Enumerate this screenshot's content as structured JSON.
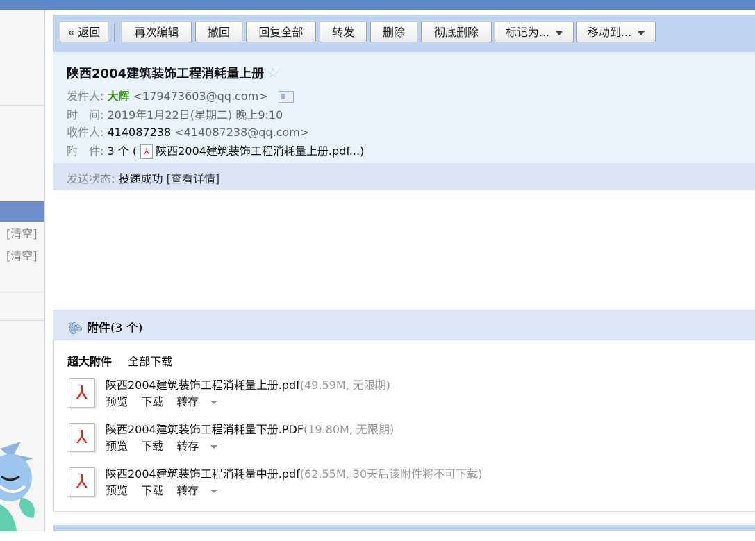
{
  "sidebar": {
    "clear_1": "[清空]",
    "clear_2": "[清空]"
  },
  "toolbar": {
    "back": "« 返回",
    "re_edit": "再次编辑",
    "recall": "撤回",
    "reply_all": "回复全部",
    "forward": "转发",
    "delete": "删除",
    "delete_permanently": "彻底删除",
    "mark_as": "标记为...",
    "move_to": "移动到..."
  },
  "email": {
    "subject": "陕西2004建筑装饰工程消耗量上册",
    "star": "☆",
    "sender_label": "发件人:",
    "sender_name": "大辉",
    "sender_email": "<179473603@qq.com>",
    "time_label": "时　间:",
    "time": "2019年1月22日(星期二) 晚上9:10",
    "recipient_label": "收件人:",
    "recipient_name": "414087238",
    "recipient_email": "<414087238@qq.com>",
    "attachment_label": "附　件:",
    "attachment_count": "3 个 (",
    "attachment_first": "陕西2004建筑装饰工程消耗量上册.pdf...)",
    "status_label": "发送状态:",
    "status_value": "投递成功",
    "status_link": "[查看详情]"
  },
  "attachments": {
    "title": "附件",
    "count": "(3 个)",
    "section": "超大附件",
    "download_all": "全部下载",
    "preview_label": "预览",
    "download_label": "下载",
    "save_label": "转存",
    "items": [
      {
        "name": "陕西2004建筑装饰工程消耗量上册.pdf",
        "meta": "(49.59M, 无限期)"
      },
      {
        "name": "陕西2004建筑装饰工程消耗量下册.PDF",
        "meta": "(19.80M, 无限期)"
      },
      {
        "name": "陕西2004建筑装饰工程消耗量中册.pdf",
        "meta": "(62.55M, 30天后该附件将不可下载)"
      }
    ]
  },
  "colors": {
    "topbar": "#5d86c8",
    "toolbar_bg": "#c0d3ee",
    "header_bg": "#eaf2fd",
    "sender_green": "#3c9a12"
  }
}
